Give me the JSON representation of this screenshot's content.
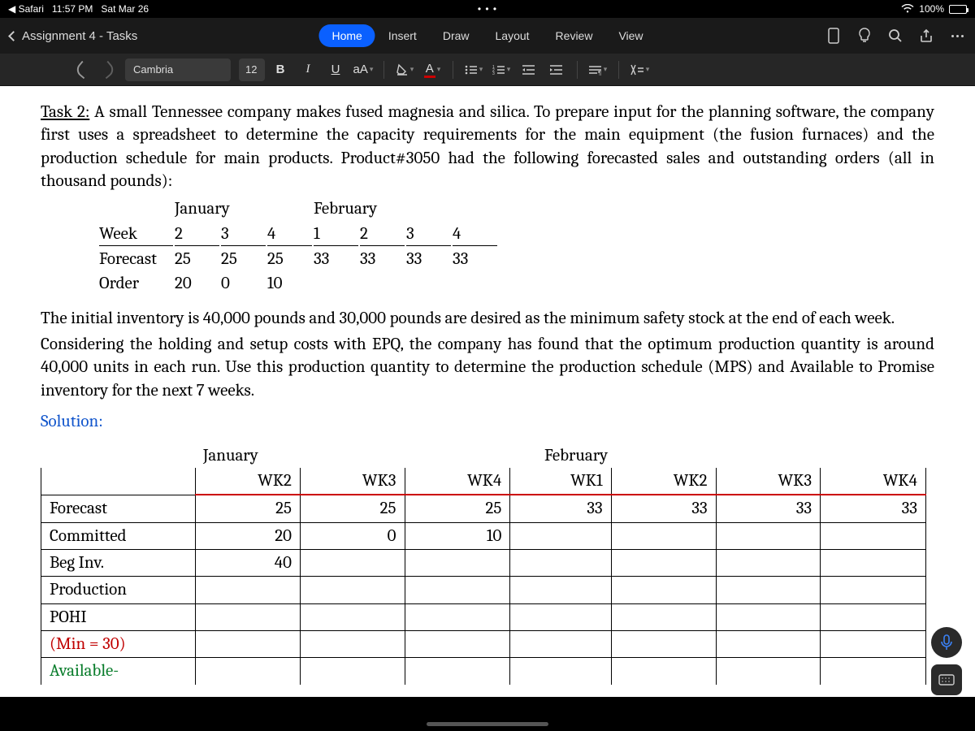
{
  "status": {
    "back_app": "Safari",
    "time": "11:57 PM",
    "date": "Sat Mar 26",
    "dots": "• • •",
    "battery": "100%"
  },
  "header": {
    "doc_title": "Assignment 4 - Tasks",
    "tabs": {
      "home": "Home",
      "insert": "Insert",
      "draw": "Draw",
      "layout": "Layout",
      "review": "Review",
      "view": "View"
    }
  },
  "fmt": {
    "font": "Cambria",
    "size": "12",
    "bold": "B",
    "italic": "I",
    "underline": "U",
    "aA": "aA"
  },
  "doc": {
    "task_label": "Task 2:",
    "task_text": " A small Tennessee company makes fused magnesia and silica. To prepare input for the planning software, the company first uses a spreadsheet to determine the capacity requirements for the main equipment (the fusion furnaces) and the production schedule for main products. Product#3050 had the following forecasted sales and outstanding orders (all in thousand pounds):",
    "months": {
      "jan": "January",
      "feb": "February"
    },
    "rows": {
      "week": "Week",
      "forecast": "Forecast",
      "order": "Order"
    },
    "week_vals": [
      "2",
      "3",
      "4",
      "1",
      "2",
      "3",
      "4"
    ],
    "forecast_vals": [
      "25",
      "25",
      "25",
      "33",
      "33",
      "33",
      "33"
    ],
    "order_vals": [
      "20",
      "0",
      "10",
      "",
      "",
      "",
      ""
    ],
    "para2": "The initial inventory is 40,000 pounds and 30,000 pounds are desired as the minimum safety stock at the end of each week.",
    "para3": "Considering the holding and setup costs with EPQ, the company has found that the optimum production quantity is around 40,000 units in each run. Use this production quantity to determine the production schedule (MPS) and Available to Promise inventory for the next 7 weeks.",
    "solution": "Solution:"
  },
  "sol": {
    "jan": "January",
    "feb": "February",
    "wk": [
      "WK2",
      "WK3",
      "WK4",
      "WK1",
      "WK2",
      "WK3",
      "WK4"
    ],
    "rows": {
      "forecast": "Forecast",
      "committed": "Committed",
      "beginv": "Beg Inv.",
      "production": "Production",
      "pohi": "POHI",
      "min": "(Min = 30)",
      "avail": "Available-"
    },
    "forecast": [
      "25",
      "25",
      "25",
      "33",
      "33",
      "33",
      "33"
    ],
    "committed": [
      "20",
      "0",
      "10",
      "",
      "",
      "",
      ""
    ],
    "beginv": [
      "40",
      "",
      "",
      "",
      "",
      "",
      ""
    ]
  }
}
